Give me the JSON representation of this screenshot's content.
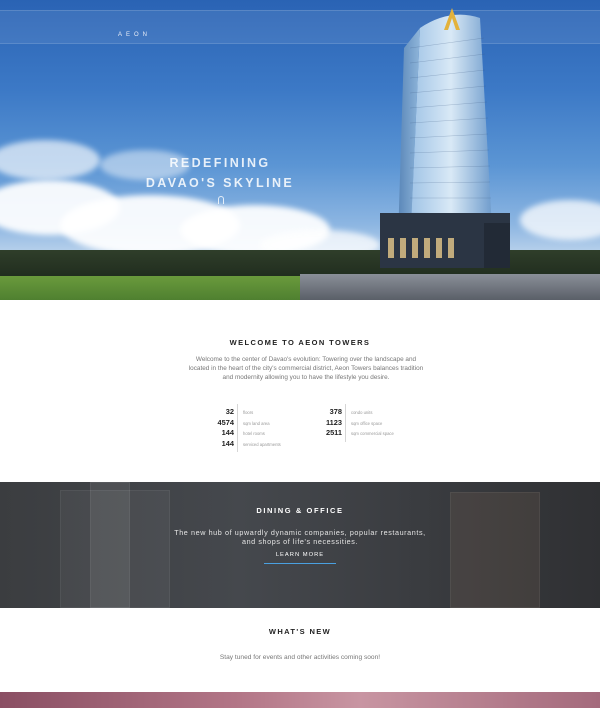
{
  "header": {
    "logo_text": "AEON"
  },
  "hero": {
    "title_line1": "REDEFINING",
    "title_line2": "DAVAO'S SKYLINE"
  },
  "welcome": {
    "title": "WELCOME TO AEON TOWERS",
    "text": "Welcome to the center of Davao's evolution: Towering over the landscape and located in the heart of the city's commercial district, Aeon Towers balances tradition and modernity allowing you to have the lifestyle you desire.",
    "stats_left": [
      {
        "value": "32",
        "label": "floors"
      },
      {
        "value": "4574",
        "label": "sqm land area"
      },
      {
        "value": "144",
        "label": "hotel rooms"
      },
      {
        "value": "144",
        "label": "serviced apartments"
      }
    ],
    "stats_right": [
      {
        "value": "378",
        "label": "condo units"
      },
      {
        "value": "1123",
        "label": "sqm office space"
      },
      {
        "value": "2511",
        "label": "sqm commercial space"
      }
    ]
  },
  "dining": {
    "title": "DINING & OFFICE",
    "text": "The new hub of upwardly dynamic companies, popular restaurants, and shops of life's necessities.",
    "button_label": "LEARN MORE"
  },
  "whats_new": {
    "title": "WHAT'S NEW",
    "text": "Stay tuned for events and other activities coming soon!"
  },
  "colors": {
    "accent": "#4aa0e0",
    "logo_gold": "#e3b23c",
    "sky": "#3c79c6"
  }
}
